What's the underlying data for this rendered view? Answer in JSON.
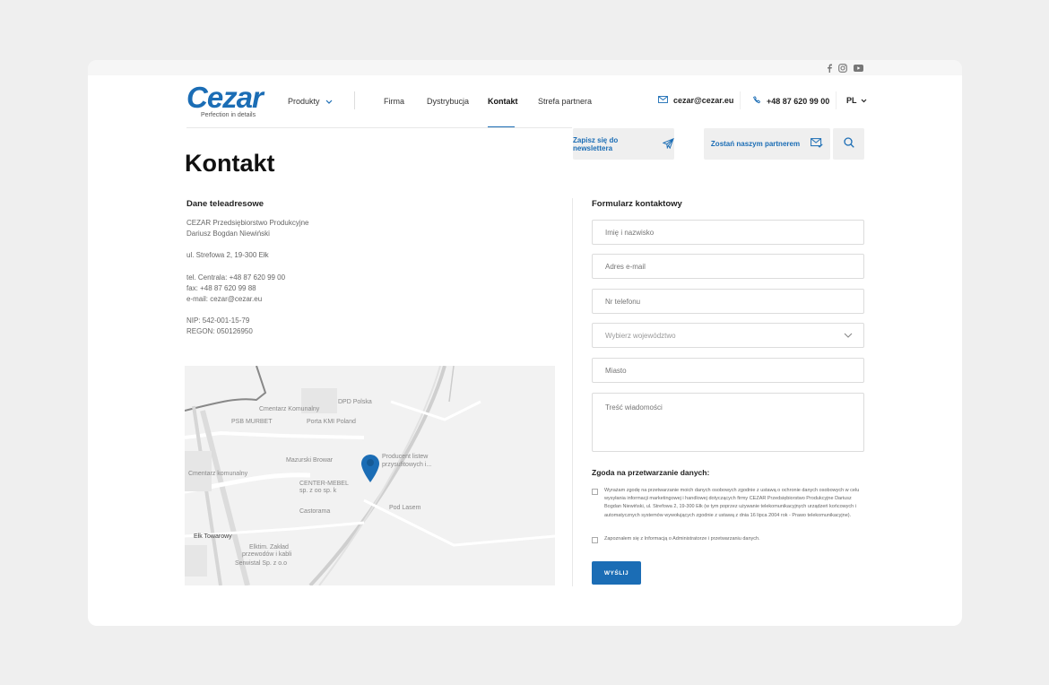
{
  "header": {
    "logo_text": "Cezar",
    "logo_tagline": "Perfection in details",
    "nav": [
      {
        "label": "Produkty"
      },
      {
        "label": "Firma"
      },
      {
        "label": "Dystrybucja"
      },
      {
        "label": "Kontakt"
      },
      {
        "label": "Strefa partnera"
      }
    ],
    "email": "cezar@cezar.eu",
    "phone": "+48 87 620 99 00",
    "lang": "PL",
    "newsletter_label": "Zapisz się do newslettera",
    "partner_label": "Zostań naszym partnerem"
  },
  "social": [
    "facebook-icon",
    "instagram-icon",
    "youtube-icon"
  ],
  "page": {
    "title": "Kontakt"
  },
  "address": {
    "heading": "Dane teleadresowe",
    "company": "CEZAR Przedsiębiorstwo Produkcyjne",
    "owner": "Dariusz Bogdan Niewiński",
    "street": "ul. Strefowa 2, 19-300 Ełk",
    "tel": "tel. Centrala: +48 87 620 99 00",
    "fax": "fax: +48 87 620 99 88",
    "email": "e-mail: cezar@cezar.eu",
    "nip": "NIP: 542-001-15-79",
    "regon": "REGON: 050126950"
  },
  "map": {
    "labels": [
      "DPD Polska",
      "Cmentarz Komunalny",
      "PSB MURBET",
      "Porta KMI Poland",
      "Mazurski Browar",
      "Producent listew",
      "przysufitowych i...",
      "Cmentarz komunalny",
      "CENTER-MEBEL",
      "sp. z oo sp. k",
      "Castorama",
      "Pod Lasem",
      "Ełk Towarowy",
      "Elktim. Zakład",
      "przewodów i kabli",
      "Serwistal Sp. z o.o"
    ]
  },
  "form": {
    "heading": "Formularz kontaktowy",
    "name_placeholder": "Imię i nazwisko",
    "email_placeholder": "Adres e-mail",
    "phone_placeholder": "Nr telefonu",
    "region_placeholder": "Wybierz województwo",
    "city_placeholder": "Miasto",
    "message_placeholder": "Treść wiadomości",
    "consent_heading": "Zgoda na przetwarzanie danych:",
    "consent_1": "Wyrażam zgodę na przetwarzanie moich danych osobowych zgodnie z ustawą o ochronie danych osobowych w celu wysyłania informacji marketingowej i handlowej dotyczących firmy CEZAR Przedsiębiorstwo Produkcyjne Dariusz Bogdan Niewiński, ul. Strefowa 2, 19-300 Ełk (w tym poprzez używanie telekomunikacyjnych urządzeń końcowych i automatycznych systemów wywołujących zgodnie z ustawą z dnia 16 lipca 2004 rok - Prawo telekomunikacyjne).",
    "consent_2": "Zapoznałem się z Informacją o Administratorze i przetwarzaniu danych.",
    "submit_label": "WYŚLIJ"
  },
  "colors": {
    "brand": "#1b6db5",
    "background": "#efefef"
  }
}
